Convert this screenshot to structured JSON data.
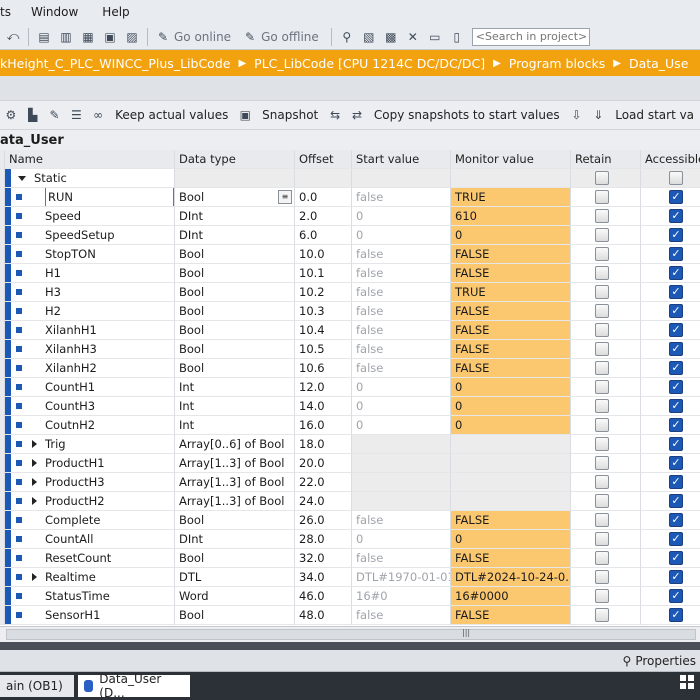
{
  "menu": [
    "ts",
    "Window",
    "Help"
  ],
  "toolbar": {
    "go_online": "Go online",
    "go_offline": "Go offline",
    "search_placeholder": "<Search in project>"
  },
  "breadcrumb": [
    "kHeight_C_PLC_WINCC_Plus_LibCode",
    "PLC_LibCode [CPU 1214C DC/DC/DC]",
    "Program blocks",
    "Data_Use"
  ],
  "editor_toolbar": {
    "keep_actual": "Keep actual values",
    "snapshot": "Snapshot",
    "copy_snapshots": "Copy snapshots to start values",
    "load_start": "Load start va"
  },
  "block_title": "ata_User",
  "columns": {
    "name": "Name",
    "type": "Data type",
    "offset": "Offset",
    "start": "Start value",
    "monitor": "Monitor value",
    "retain": "Retain",
    "accessible": "Accessible"
  },
  "static_label": "Static",
  "rows": [
    {
      "name": "RUN",
      "type": "Bool",
      "offset": "0.0",
      "start": "false",
      "monitor": "TRUE",
      "expand": false
    },
    {
      "name": "Speed",
      "type": "DInt",
      "offset": "2.0",
      "start": "0",
      "monitor": "610",
      "expand": false
    },
    {
      "name": "SpeedSetup",
      "type": "DInt",
      "offset": "6.0",
      "start": "0",
      "monitor": "0",
      "expand": false
    },
    {
      "name": "StopTON",
      "type": "Bool",
      "offset": "10.0",
      "start": "false",
      "monitor": "FALSE",
      "expand": false
    },
    {
      "name": "H1",
      "type": "Bool",
      "offset": "10.1",
      "start": "false",
      "monitor": "FALSE",
      "expand": false
    },
    {
      "name": "H3",
      "type": "Bool",
      "offset": "10.2",
      "start": "false",
      "monitor": "TRUE",
      "expand": false
    },
    {
      "name": "H2",
      "type": "Bool",
      "offset": "10.3",
      "start": "false",
      "monitor": "FALSE",
      "expand": false
    },
    {
      "name": "XilanhH1",
      "type": "Bool",
      "offset": "10.4",
      "start": "false",
      "monitor": "FALSE",
      "expand": false
    },
    {
      "name": "XilanhH3",
      "type": "Bool",
      "offset": "10.5",
      "start": "false",
      "monitor": "FALSE",
      "expand": false
    },
    {
      "name": "XilanhH2",
      "type": "Bool",
      "offset": "10.6",
      "start": "false",
      "monitor": "FALSE",
      "expand": false
    },
    {
      "name": "CountH1",
      "type": "Int",
      "offset": "12.0",
      "start": "0",
      "monitor": "0",
      "expand": false
    },
    {
      "name": "CountH3",
      "type": "Int",
      "offset": "14.0",
      "start": "0",
      "monitor": "0",
      "expand": false
    },
    {
      "name": "CoutnH2",
      "type": "Int",
      "offset": "16.0",
      "start": "0",
      "monitor": "0",
      "expand": false
    },
    {
      "name": "Trig",
      "type": "Array[0..6] of Bool",
      "offset": "18.0",
      "start": "",
      "monitor": "",
      "expand": true
    },
    {
      "name": "ProductH1",
      "type": "Array[1..3] of Bool",
      "offset": "20.0",
      "start": "",
      "monitor": "",
      "expand": true
    },
    {
      "name": "ProductH3",
      "type": "Array[1..3] of Bool",
      "offset": "22.0",
      "start": "",
      "monitor": "",
      "expand": true
    },
    {
      "name": "ProductH2",
      "type": "Array[1..3] of Bool",
      "offset": "24.0",
      "start": "",
      "monitor": "",
      "expand": true
    },
    {
      "name": "Complete",
      "type": "Bool",
      "offset": "26.0",
      "start": "false",
      "monitor": "FALSE",
      "expand": false
    },
    {
      "name": "CountAll",
      "type": "DInt",
      "offset": "28.0",
      "start": "0",
      "monitor": "0",
      "expand": false
    },
    {
      "name": "ResetCount",
      "type": "Bool",
      "offset": "32.0",
      "start": "false",
      "monitor": "FALSE",
      "expand": false
    },
    {
      "name": "Realtime",
      "type": "DTL",
      "offset": "34.0",
      "start": "DTL#1970-01-01-",
      "monitor": "DTL#2024-10-24-0...",
      "expand": true
    },
    {
      "name": "StatusTime",
      "type": "Word",
      "offset": "46.0",
      "start": "16#0",
      "monitor": "16#0000",
      "expand": false
    },
    {
      "name": "SensorH1",
      "type": "Bool",
      "offset": "48.0",
      "start": "false",
      "monitor": "FALSE",
      "expand": false
    }
  ],
  "properties_tab": "Properties",
  "taskbar": {
    "item1": "ain (OB1)",
    "item2": "Data_User (D..."
  },
  "colors": {
    "breadcrumb_bg": "#f2a20f",
    "monitor_bg": "#fbc76f",
    "checkbox_blue": "#1c58b5"
  }
}
